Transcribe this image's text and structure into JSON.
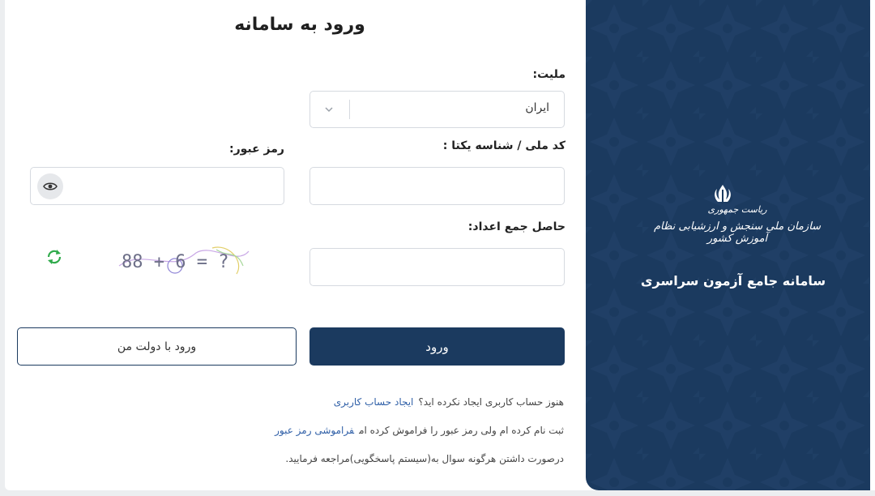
{
  "login": {
    "title": "ورود به سامانه",
    "nationality_label": "ملیت:",
    "nationality_value": "ایران",
    "national_code_label": "کد ملی / شناسه یکتا :",
    "password_label": "رمز عبور:",
    "captcha_label": "حاصل جمع اعداد:",
    "captcha_expression": "88 + 6 = ?",
    "login_button": "ورود",
    "gov_login_button": "ورود با دولت من"
  },
  "help": {
    "no_account_text": "هنوز حساب کاربری ایجاد نکرده اید؟",
    "create_account_link": "ایجاد حساب کاربری",
    "forgot_text": "ثبت نام کرده ام ولی رمز عبور را فراموش کرده ام",
    "forgot_link": "فراموشی رمز عبور",
    "support_text": "درصورت داشتن هرگونه سوال به(سیستم پاسخگویی)مراجعه فرمایید."
  },
  "brand": {
    "org_line1": "ریاست جمهوری",
    "org_line2": "سازمان ملی سنجش و ارزشیابی نظام آموزش کشور",
    "system_title": "سامانه جامع آزمون سراسری"
  },
  "colors": {
    "primary": "#1b3a5f",
    "link": "#2f5fa7",
    "refresh": "#2eaa4a"
  },
  "icons": {
    "password_toggle": "eye-icon",
    "captcha_refresh": "refresh-icon",
    "select_arrow": "chevron-down-icon",
    "emblem": "emblem-icon"
  }
}
